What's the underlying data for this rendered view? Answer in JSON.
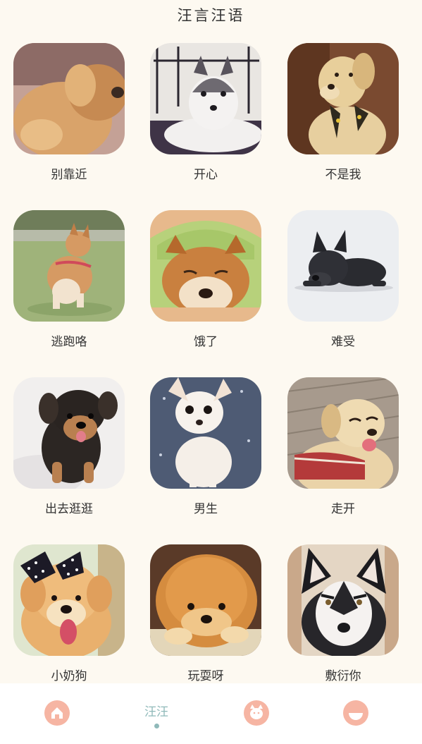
{
  "header": {
    "title": "汪言汪语"
  },
  "cards": [
    {
      "label": "别靠近"
    },
    {
      "label": "开心"
    },
    {
      "label": "不是我"
    },
    {
      "label": "逃跑咯"
    },
    {
      "label": "饿了"
    },
    {
      "label": "难受"
    },
    {
      "label": "出去逛逛"
    },
    {
      "label": "男生"
    },
    {
      "label": "走开"
    },
    {
      "label": "小奶狗"
    },
    {
      "label": "玩耍呀"
    },
    {
      "label": "敷衍你"
    }
  ],
  "tabbar": {
    "tab_active_label": "汪汪",
    "icons": [
      "home-icon",
      "paw-icon",
      "cat-icon",
      "face-icon"
    ]
  },
  "colors": {
    "background": "#fdf9f1",
    "tab_icon_bg": "#f6b5a3",
    "tab_active": "#8fb9b9"
  }
}
